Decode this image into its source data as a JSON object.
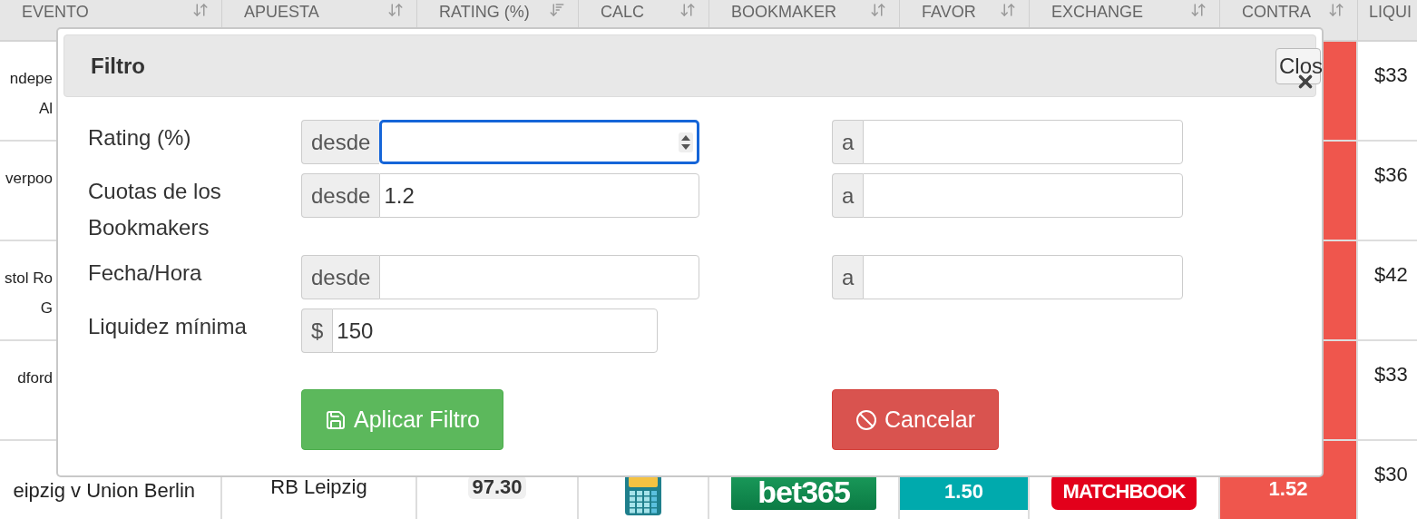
{
  "table": {
    "columns": [
      {
        "label": "EVENTO",
        "sorted": false
      },
      {
        "label": "APUESTA",
        "sorted": false
      },
      {
        "label": "RATING (%)",
        "sorted": true
      },
      {
        "label": "CALC",
        "sorted": false
      },
      {
        "label": "BOOKMAKER",
        "sorted": false
      },
      {
        "label": "FAVOR",
        "sorted": false
      },
      {
        "label": "EXCHANGE",
        "sorted": false
      },
      {
        "label": "CONTRA",
        "sorted": false
      },
      {
        "label": "LIQUI"
      }
    ],
    "rows": [
      {
        "covered": true,
        "evento": [
          "ndepe",
          "Al"
        ],
        "liquidez": "$33"
      },
      {
        "covered": true,
        "evento": [
          "verpoo"
        ],
        "liquidez": "$36"
      },
      {
        "covered": true,
        "evento": [
          "stol Ro",
          "G"
        ],
        "liquidez": "$42"
      },
      {
        "covered": true,
        "evento": [
          "dford"
        ],
        "liquidez": "$33"
      },
      {
        "covered": false,
        "evento": [
          "eipzig v Union Berlin"
        ],
        "apuesta": "RB Leipzig",
        "rating": "97.30",
        "bookmaker": "bet365",
        "favor": "1.50",
        "exchange": "MATCHBOOK",
        "contra": "1.52",
        "liquidez": "$30"
      }
    ]
  },
  "dialog": {
    "title": "Filtro",
    "close_button": "Clos",
    "fields": [
      {
        "label": "Rating (%)",
        "from": {
          "addon": "desde",
          "focused": true
        },
        "to": {
          "addon": "a",
          "focused": false
        }
      },
      {
        "label": "Cuotas de los Bookmakers",
        "from": {
          "addon": "desde",
          "value": "1.2",
          "focused": false
        },
        "to": {
          "addon": "a",
          "focused": false
        }
      },
      {
        "label": "Fecha/Hora",
        "from": {
          "addon": "desde",
          "focused": false
        },
        "to": {
          "addon": "a",
          "focused": false
        }
      },
      {
        "label": "Liquidez mínima",
        "from": {
          "addon": "$",
          "value": "150",
          "focused": false
        }
      }
    ],
    "buttons": [
      {
        "label": "Aplicar Filtro",
        "kind": "apply"
      },
      {
        "label": "Cancelar",
        "kind": "cancel"
      }
    ]
  }
}
